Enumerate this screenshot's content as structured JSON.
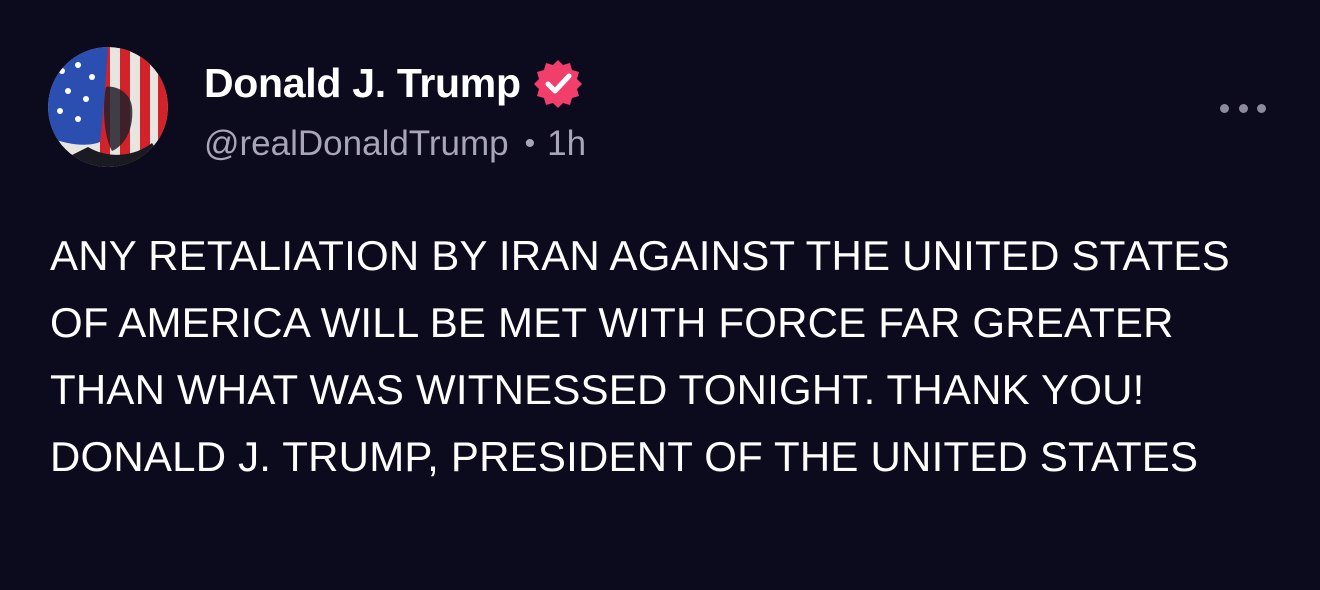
{
  "author": {
    "display_name": "Donald J. Trump",
    "handle": "@realDonaldTrump",
    "separator": "•",
    "timestamp": "1h",
    "verified_icon": "verified-badge-icon",
    "avatar_icon": "profile-avatar"
  },
  "menu": {
    "icon": "more-options-icon"
  },
  "post": {
    "text": "ANY RETALIATION BY IRAN AGAINST THE UNITED STATES OF AMERICA WILL BE MET WITH FORCE FAR GREATER THAN WHAT WAS WITNESSED TONIGHT. THANK YOU! DONALD J. TRUMP, PRESIDENT OF THE UNITED STATES"
  },
  "colors": {
    "background": "#0c0a1d",
    "text_primary": "#ffffff",
    "text_secondary": "#a8a5b6",
    "verified_badge": "#f23e6b"
  }
}
